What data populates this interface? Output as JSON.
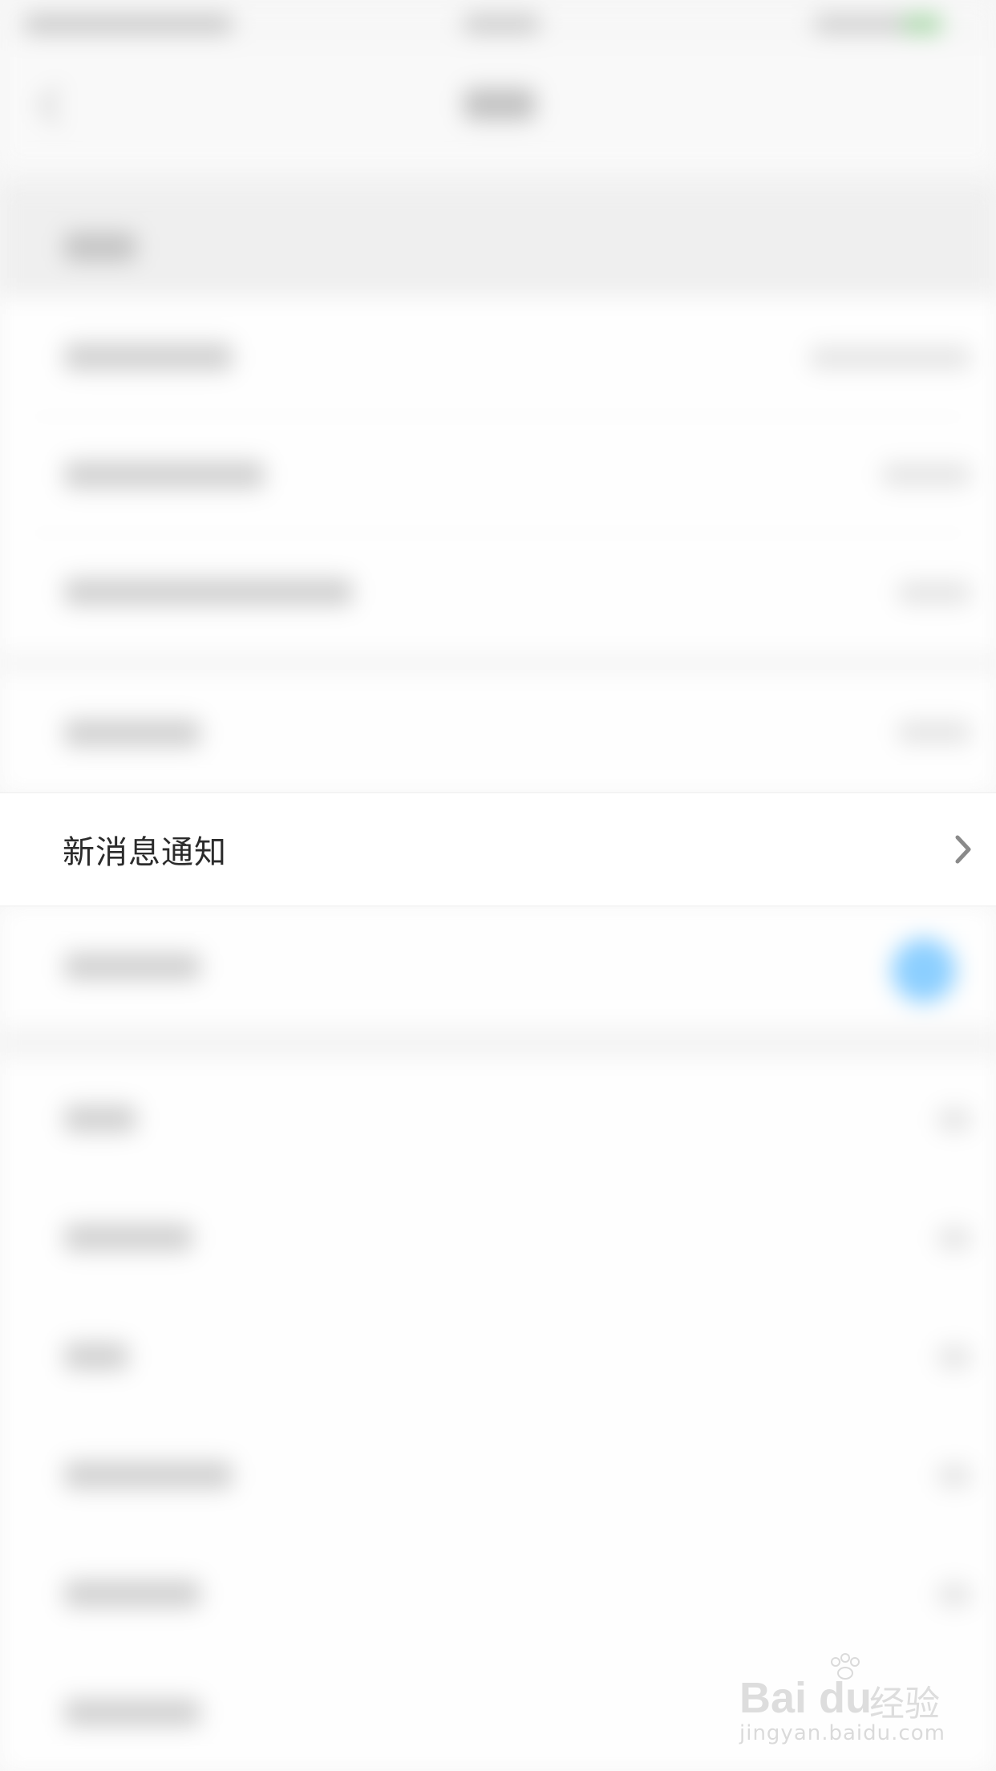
{
  "screen": {
    "focused_row": {
      "label": "新消息通知",
      "chevron": "chevron-right-icon"
    }
  },
  "colors": {
    "background": "#f6f6f6",
    "row_background": "#ffffff",
    "text": "#2b2b2b",
    "toggle_blue": "#8ccfff",
    "battery_green": "#a9d8a9"
  },
  "watermark": {
    "brand": "Bai du",
    "brand_suffix": "经验",
    "url": "jingyan.baidu.com"
  }
}
